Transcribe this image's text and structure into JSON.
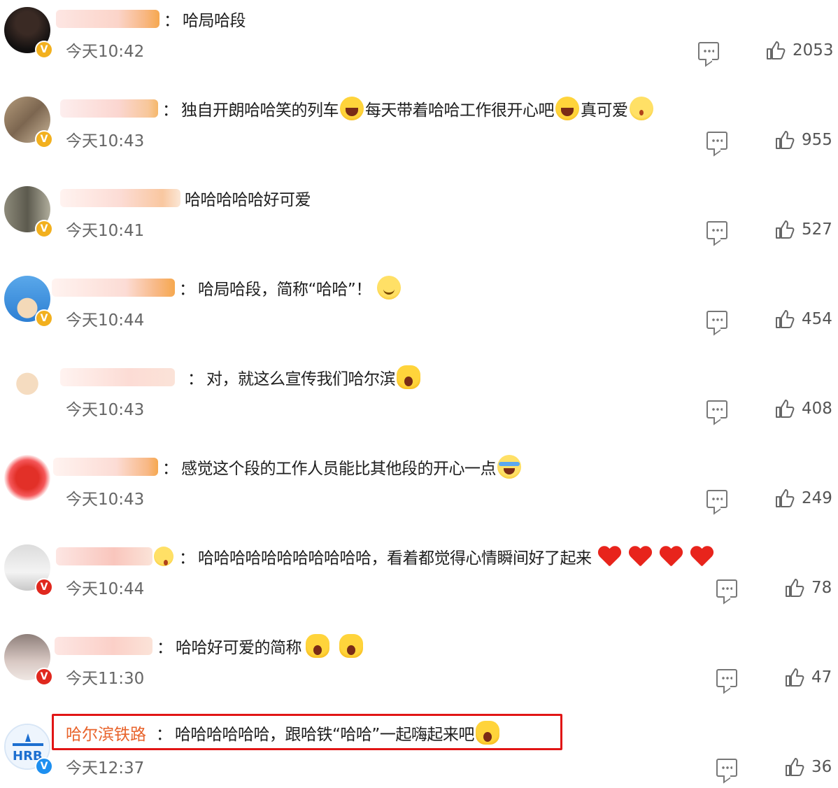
{
  "comments": [
    {
      "text": "哈局哈段",
      "time": "今天10:42",
      "likes": "2053"
    },
    {
      "text": "独自开朗哈哈笑的列车",
      "text2": "每天带着哈哈工作很开心吧",
      "text3": "真可爱",
      "time": "今天10:43",
      "likes": "955"
    },
    {
      "text": "哈哈哈哈哈好可爱",
      "time": "今天10:41",
      "likes": "527"
    },
    {
      "text": "哈局哈段，简称“哈哈”！",
      "time": "今天10:44",
      "likes": "454"
    },
    {
      "text": "对，就这么宣传我们哈尔滨",
      "time": "今天10:43",
      "likes": "408"
    },
    {
      "text": "感觉这个段的工作人员能比其他段的开心一点",
      "time": "今天10:43",
      "likes": "249"
    },
    {
      "text": "哈哈哈哈哈哈哈哈哈哈哈，看着都觉得心情瞬间好了起来",
      "time": "今天10:44",
      "likes": "78"
    },
    {
      "text": "哈哈好可爱的简称",
      "time": "今天11:30",
      "likes": "47"
    },
    {
      "username": "哈尔滨铁路",
      "text": "哈哈哈哈哈哈，跟哈铁“哈哈”一起嗨起来吧",
      "time": "今天12:37",
      "likes": "36"
    }
  ],
  "colors": {
    "official_name": "#e8632b",
    "highlight_border": "#e11515",
    "verified_gold": "#f2b01e",
    "verified_red": "#e0281e",
    "verified_blue": "#1d8ff0"
  },
  "icons": {
    "reply": "comment-bubble-icon",
    "like": "thumbs-up-icon",
    "verified": "verified-badge-icon"
  }
}
